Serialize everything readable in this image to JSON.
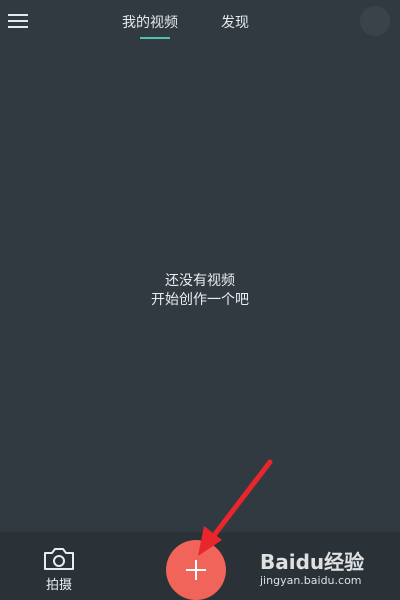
{
  "header": {
    "tabs": [
      {
        "label": "我的视频",
        "active": true
      },
      {
        "label": "发现",
        "active": false
      }
    ],
    "accent_color": "#4fc2b0"
  },
  "main": {
    "empty_line1": "还没有视频",
    "empty_line2": "开始创作一个吧"
  },
  "bottom": {
    "shoot_label": "拍摄",
    "add_color": "#f0645a"
  },
  "watermark": {
    "main": "Baidu经验",
    "sub": "jingyan.baidu.com"
  },
  "colors": {
    "background": "#323a41",
    "bottom_bar": "#2a3137",
    "annotation_arrow": "#e8262c"
  }
}
